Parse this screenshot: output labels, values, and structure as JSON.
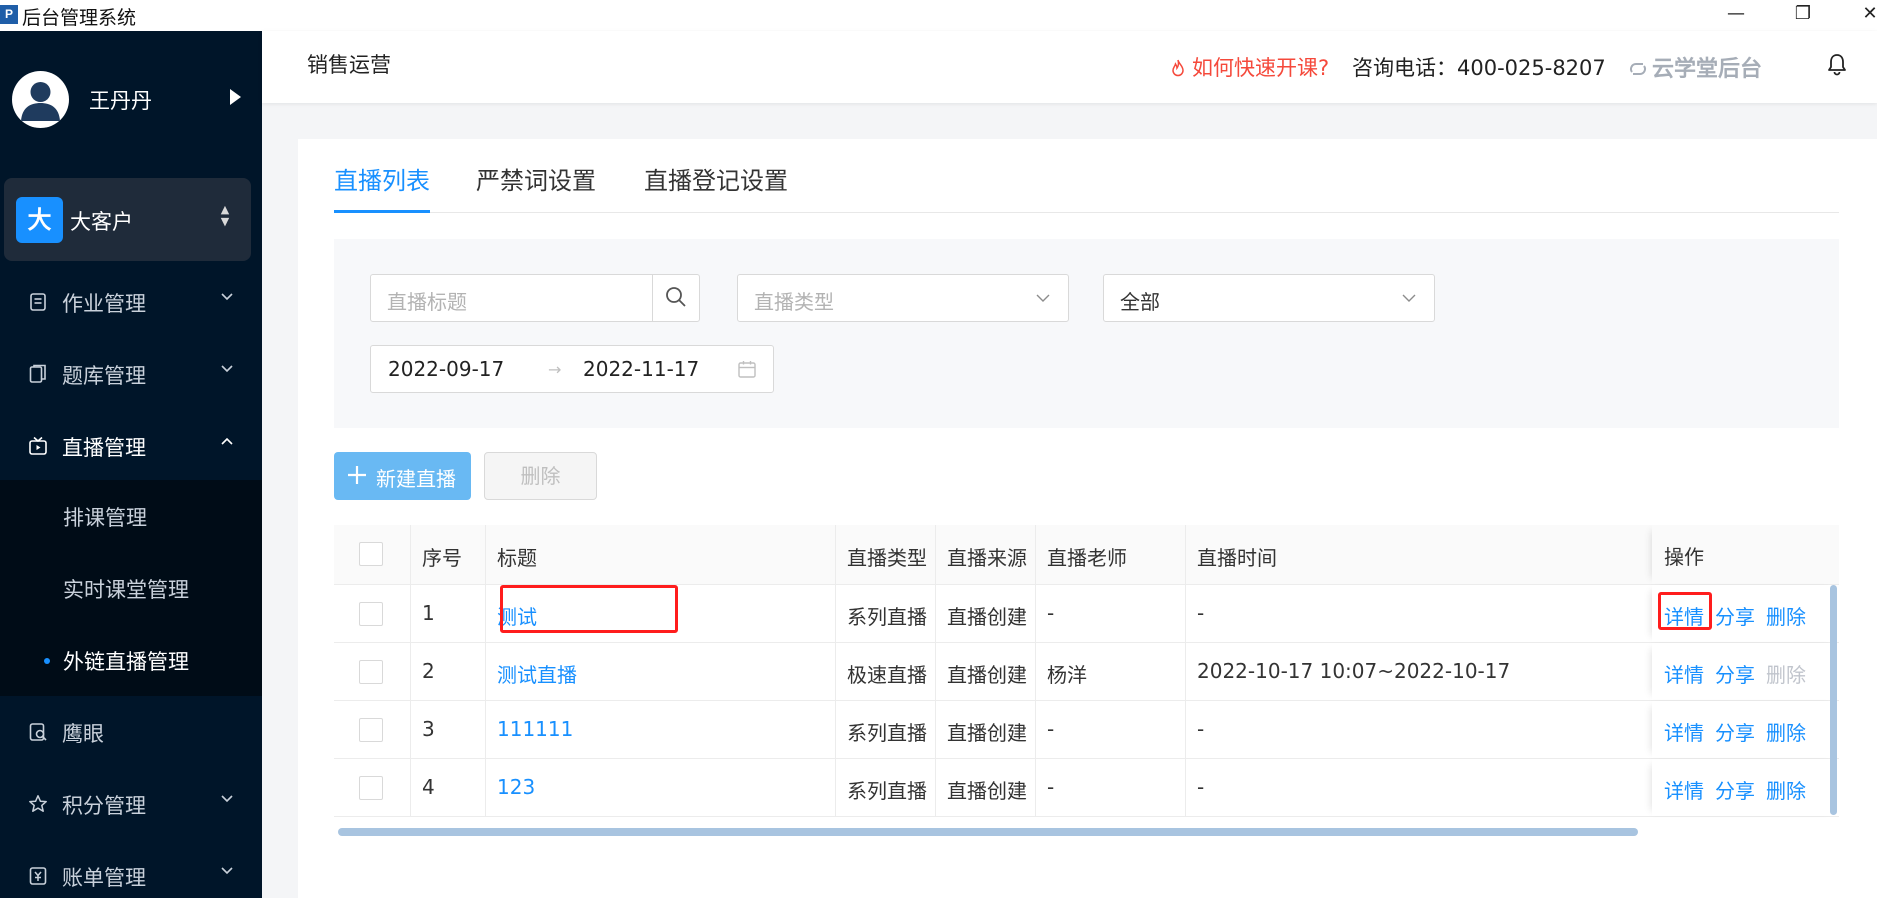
{
  "window": {
    "logo_letter": "P",
    "title": "后台管理系统",
    "minimize": "—",
    "maximize": "❐",
    "close": "✕"
  },
  "sidebar": {
    "user_name": "王丹丹",
    "org_badge": "大",
    "org_name": "大客户",
    "menu": [
      {
        "label": "作业管理"
      },
      {
        "label": "题库管理"
      },
      {
        "label": "直播管理"
      },
      {
        "label": "鹰眼"
      },
      {
        "label": "积分管理"
      },
      {
        "label": "账单管理"
      }
    ],
    "submenu": [
      {
        "label": "排课管理"
      },
      {
        "label": "实时课堂管理"
      },
      {
        "label": "外链直播管理"
      }
    ]
  },
  "header": {
    "crumb": "销售运营",
    "help_link": "如何快速开课?",
    "phone": "咨询电话：400-025-8207",
    "brand": "云学堂后台"
  },
  "tabs": [
    {
      "label": "直播列表"
    },
    {
      "label": "严禁词设置"
    },
    {
      "label": "直播登记设置"
    }
  ],
  "filters": {
    "title_placeholder": "直播标题",
    "type_placeholder": "直播类型",
    "status_value": "全部",
    "date_start": "2022-09-17",
    "date_arrow": "→",
    "date_end": "2022-11-17"
  },
  "actions": {
    "new_label": "新建直播",
    "delete_label": "删除"
  },
  "table": {
    "columns": [
      "序号",
      "标题",
      "直播类型",
      "直播来源",
      "直播老师",
      "直播时间",
      "操作"
    ],
    "rows": [
      {
        "idx": "1",
        "title": "测试",
        "type": "系列直播",
        "source": "直播创建",
        "teacher": "-",
        "time": "-",
        "op_detail": "详情",
        "op_share": "分享",
        "op_delete": "删除",
        "delete_enabled": true
      },
      {
        "idx": "2",
        "title": "测试直播",
        "type": "极速直播",
        "source": "直播创建",
        "teacher": "杨洋",
        "time": "2022-10-17 10:07~2022-10-17",
        "op_detail": "详情",
        "op_share": "分享",
        "op_delete": "删除",
        "delete_enabled": false
      },
      {
        "idx": "3",
        "title": "111111",
        "type": "系列直播",
        "source": "直播创建",
        "teacher": "-",
        "time": "-",
        "op_detail": "详情",
        "op_share": "分享",
        "op_delete": "删除",
        "delete_enabled": true
      },
      {
        "idx": "4",
        "title": "123",
        "type": "系列直播",
        "source": "直播创建",
        "teacher": "-",
        "time": "-",
        "op_detail": "详情",
        "op_share": "分享",
        "op_delete": "删除",
        "delete_enabled": true
      }
    ]
  },
  "colors": {
    "sidebar_bg": "#001529",
    "accent": "#1890ff",
    "help_red": "#f5493b",
    "highlight": "#ff1d1d"
  },
  "icons": {
    "avatar": "user-avatar-icon",
    "menu": [
      "homework-icon",
      "question-bank-icon",
      "live-icon",
      "eagle-eye-icon",
      "star-icon",
      "bill-icon"
    ],
    "search": "search-icon",
    "calendar": "calendar-icon",
    "bell": "bell-icon"
  }
}
